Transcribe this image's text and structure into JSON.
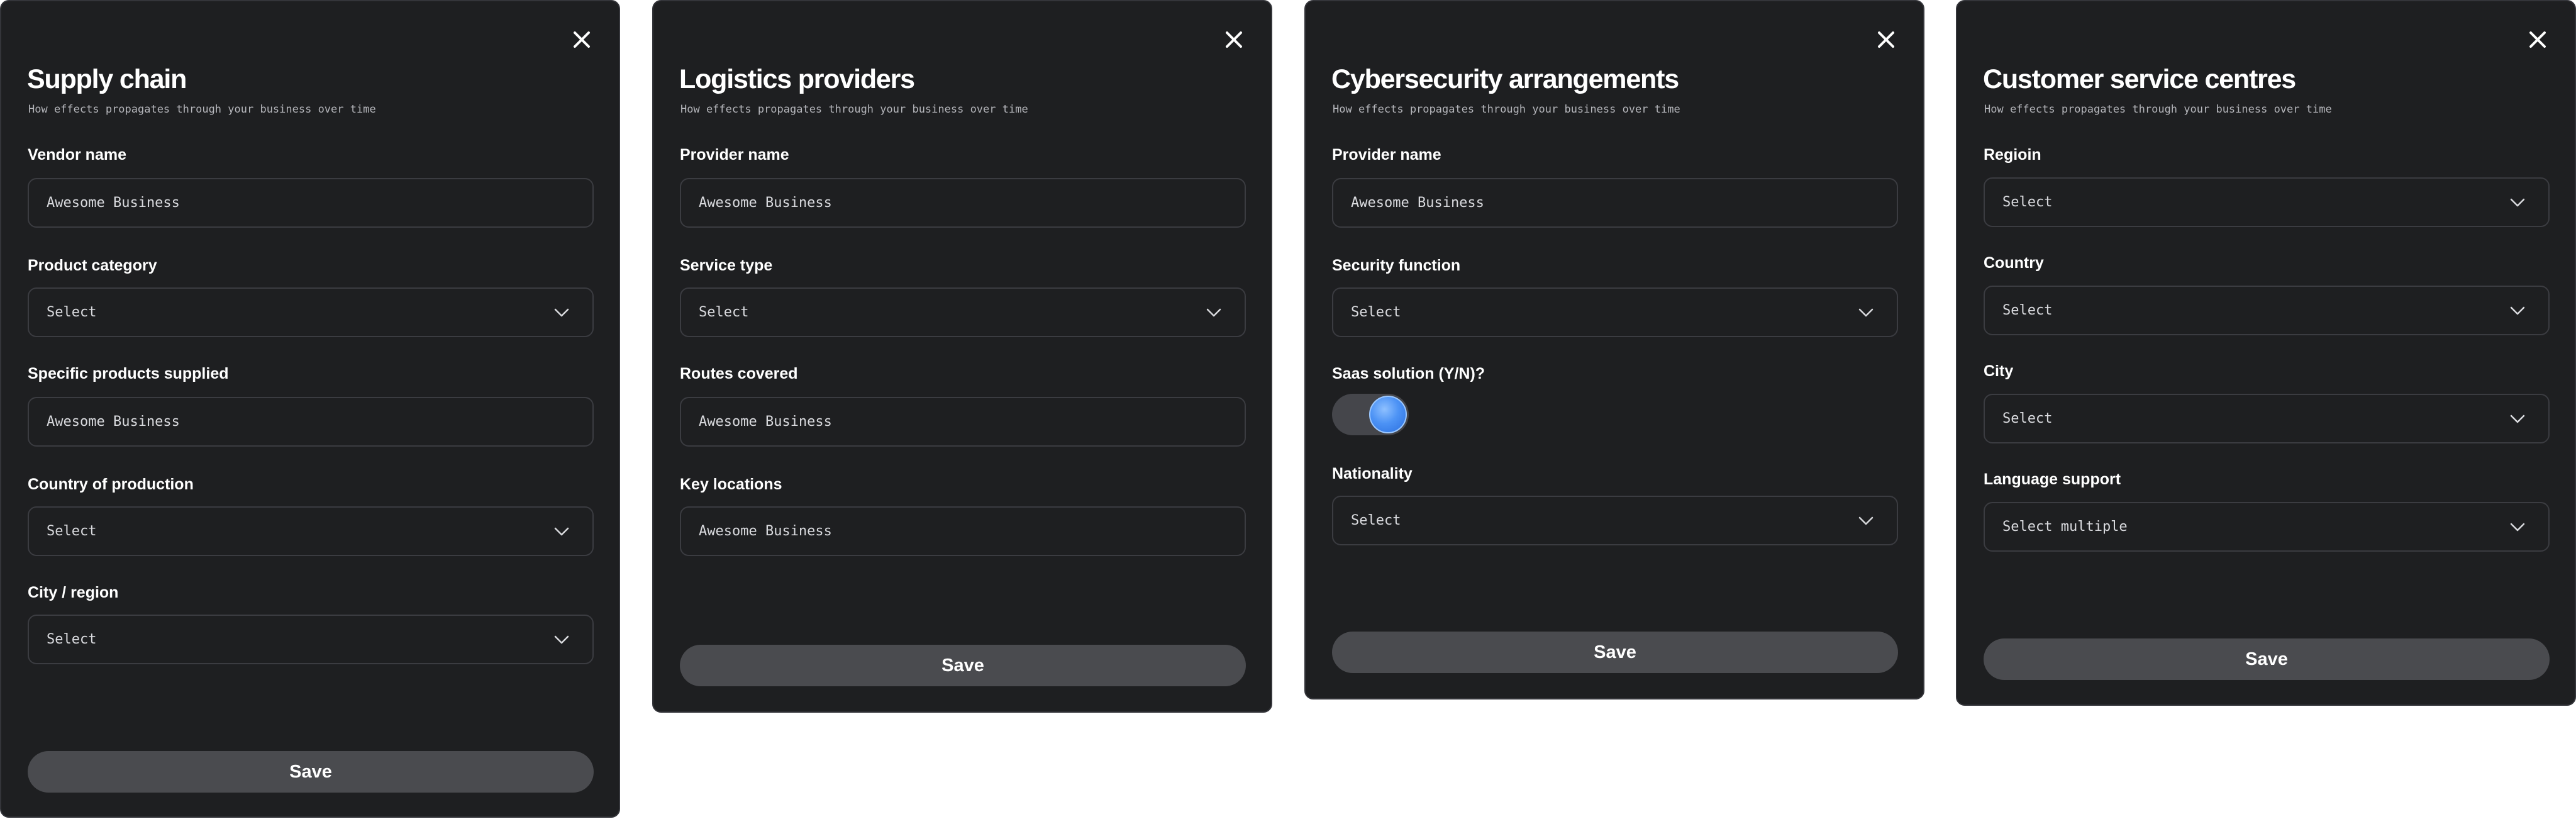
{
  "panels": [
    {
      "title": "Supply chain",
      "subtitle": "How effects propagates through your business over time",
      "fields": [
        {
          "label": "Vendor name",
          "value": "Awesome Business"
        },
        {
          "label": "Product category",
          "value": "Select"
        },
        {
          "label": "Specific products supplied",
          "value": "Awesome Business"
        },
        {
          "label": "Country of production",
          "value": "Select"
        },
        {
          "label": "City / region",
          "value": "Select"
        }
      ],
      "save_label": "Save"
    },
    {
      "title": "Logistics providers",
      "subtitle": "How effects propagates through your business over time",
      "fields": [
        {
          "label": "Provider name",
          "value": "Awesome Business"
        },
        {
          "label": "Service type",
          "value": "Select"
        },
        {
          "label": "Routes covered",
          "value": "Awesome Business"
        },
        {
          "label": "Key locations",
          "value": "Awesome Business"
        }
      ],
      "save_label": "Save"
    },
    {
      "title": "Cybersecurity arrangements",
      "subtitle": "How effects propagates through your business over time",
      "fields": [
        {
          "label": "Provider name",
          "value": "Awesome Business"
        },
        {
          "label": "Security function",
          "value": "Select"
        },
        {
          "label": "Saas solution (Y/N)?",
          "value": true
        },
        {
          "label": "Nationality",
          "value": "Select"
        }
      ],
      "save_label": "Save"
    },
    {
      "title": "Customer service centres",
      "subtitle": "How effects propagates through your business over time",
      "fields": [
        {
          "label": "Regioin",
          "value": "Select"
        },
        {
          "label": "Country",
          "value": "Select"
        },
        {
          "label": "City",
          "value": "Select"
        },
        {
          "label": "Language support",
          "value": "Select multiple"
        }
      ],
      "save_label": "Save"
    }
  ],
  "icons": {
    "close": "close-icon",
    "dropdown": "chevron-down-icon"
  },
  "colors": {
    "panel_bg": "#1e1f21",
    "field_border": "#3b3c41",
    "button_bg": "#4a4b4f",
    "toggle_on": "#4d93f5"
  }
}
